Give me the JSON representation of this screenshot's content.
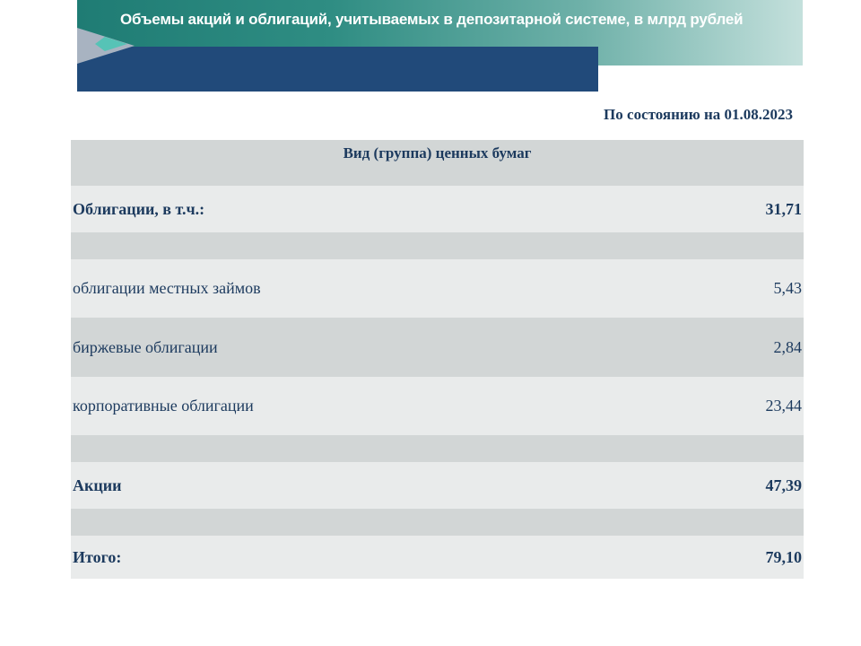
{
  "header": {
    "title": "Объемы акций и облигаций, учитываемых в депозитарной системе, в млрд рублей"
  },
  "date_label": "По состоянию на 01.08.2023",
  "table": {
    "column_header": "Вид (группа) ценных бумаг",
    "rows": [
      {
        "label": "Облигации, в т.ч.:",
        "value": "31,71"
      },
      {
        "label": "облигации местных займов",
        "value": "5,43"
      },
      {
        "label": "биржевые облигации",
        "value": "2,84"
      },
      {
        "label": "корпоративные облигации",
        "value": "23,44"
      },
      {
        "label": "Акции",
        "value": "47,39"
      },
      {
        "label": "Итого:",
        "value": "79,10"
      }
    ]
  },
  "colors": {
    "navy": "#214a7a",
    "teal": "#1f7c74",
    "text": "#1c3a5e",
    "row_dark": "#d2d6d6",
    "row_light": "#e9ebeb"
  }
}
